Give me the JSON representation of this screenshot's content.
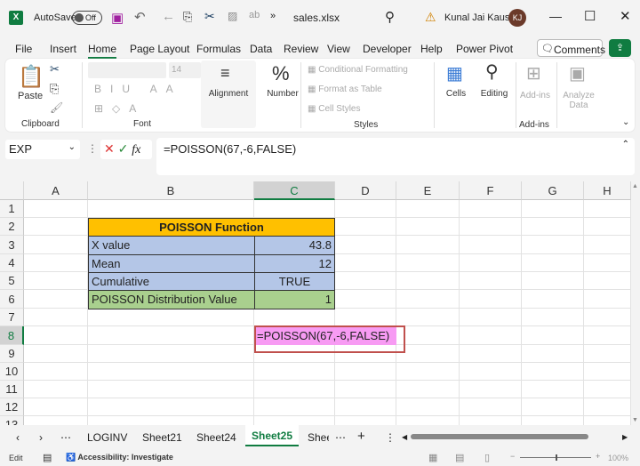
{
  "titlebar": {
    "autosave": "AutoSave",
    "toggle": "Off",
    "filename": "sales.xlsx",
    "user": "Kunal Jai Kaushik",
    "initials": "KJ",
    "more": "»"
  },
  "menu": {
    "items": [
      "File",
      "Insert",
      "Home",
      "Page Layout",
      "Formulas",
      "Data",
      "Review",
      "View",
      "Developer",
      "Help",
      "Power Pivot"
    ],
    "comments": "Comments"
  },
  "ribbon": {
    "paste": "Paste",
    "clipboard": "Clipboard",
    "font_size": "14",
    "font": "Font",
    "alignment": "Alignment",
    "number": "Number",
    "cond_format": "Conditional Formatting",
    "format_table": "Format as Table",
    "cell_styles": "Cell Styles",
    "styles": "Styles",
    "cells": "Cells",
    "editing": "Editing",
    "addins": "Add-ins",
    "analyze": "Analyze Data",
    "addins_group": "Add-ins"
  },
  "formula_bar": {
    "name_box": "EXP",
    "fx": "fx",
    "formula": "=POISSON(67,-6,FALSE)"
  },
  "columns": [
    "A",
    "B",
    "C",
    "D",
    "E",
    "F",
    "G",
    "H"
  ],
  "rows": [
    "1",
    "2",
    "3",
    "4",
    "5",
    "6",
    "7",
    "8",
    "9",
    "10",
    "11",
    "12",
    "13"
  ],
  "table": {
    "title": "POISSON Function",
    "rows": [
      {
        "label": "X value",
        "value": "43.8"
      },
      {
        "label": "Mean",
        "value": "12"
      },
      {
        "label": "Cumulative",
        "value": "TRUE"
      },
      {
        "label": "POISSON Distribution Value",
        "value": "1"
      }
    ]
  },
  "edit_cell": "=POISSON(67,-6,FALSE)",
  "colors": {
    "header": "#ffc000",
    "blue": "#b4c6e7",
    "green": "#a9d08e",
    "edit": "#f79bf3",
    "excel": "#107c41"
  },
  "sheets": [
    "LOGINV",
    "Sheet21",
    "Sheet24",
    "Sheet25",
    "Shee"
  ],
  "active_sheet": "Sheet25",
  "status": {
    "mode": "Edit",
    "accessibility": "Accessibility: Investigate",
    "zoom": "100%"
  }
}
